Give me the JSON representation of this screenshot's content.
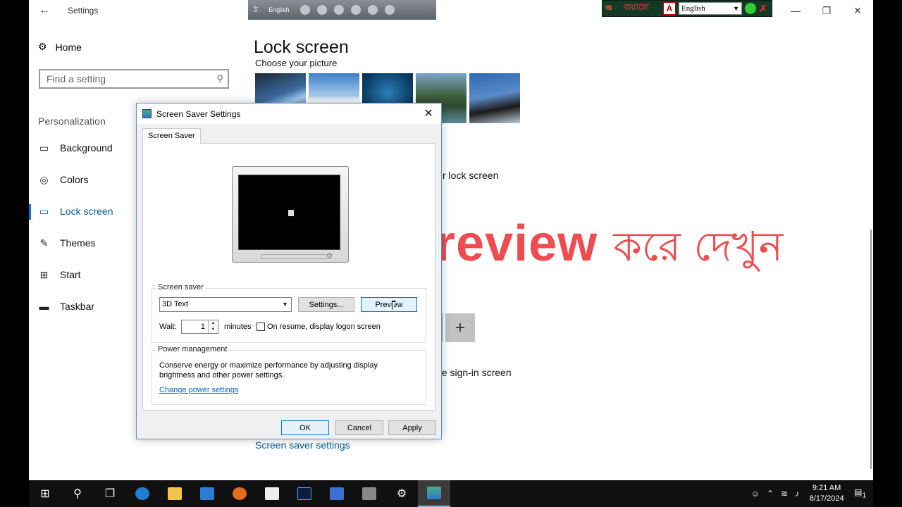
{
  "window": {
    "title": "Settings",
    "controls": {
      "minimize": "—",
      "maximize": "❐",
      "close": "✕"
    }
  },
  "bijoy_toolbar": {
    "language": "English"
  },
  "avro_toolbar": {
    "label_bangla": "বায়ান্নো",
    "language": "English"
  },
  "nav": {
    "home": "Home",
    "search_placeholder": "Find a setting",
    "section": "Personalization",
    "items": [
      {
        "label": "Background",
        "icon": "image-icon"
      },
      {
        "label": "Colors",
        "icon": "palette-icon"
      },
      {
        "label": "Lock screen",
        "icon": "lock-screen-icon"
      },
      {
        "label": "Themes",
        "icon": "brush-icon"
      },
      {
        "label": "Start",
        "icon": "start-icon"
      },
      {
        "label": "Taskbar",
        "icon": "taskbar-icon"
      }
    ]
  },
  "main": {
    "title": "Lock screen",
    "choose_picture": "Choose your picture",
    "partial_lock_screen": "r lock screen",
    "partial_signin": "he sign-in screen",
    "add_symbol": "+",
    "screen_saver_link": "Screen saver settings"
  },
  "overlay": {
    "english": "Preview",
    "bangla": "করে দেখুন"
  },
  "dialog": {
    "title": "Screen Saver Settings",
    "tab": "Screen Saver",
    "screen_saver_group": "Screen saver",
    "selected_saver": "3D Text",
    "settings_button": "Settings...",
    "preview_button": "Preview",
    "wait_label": "Wait:",
    "wait_value": "1",
    "minutes_label": "minutes",
    "logon_label": "On resume, display logon screen",
    "power_group": "Power management",
    "power_text": "Conserve energy or maximize performance by adjusting display brightness and other power settings.",
    "power_link": "Change power settings",
    "ok": "OK",
    "cancel": "Cancel",
    "apply": "Apply"
  },
  "taskbar": {
    "time": "9:21 AM",
    "date": "8/17/2024",
    "notifications": "1"
  },
  "colors": {
    "accent": "#0078d7",
    "overlay_red": "#f04b4f",
    "taskbar": "#101010"
  }
}
